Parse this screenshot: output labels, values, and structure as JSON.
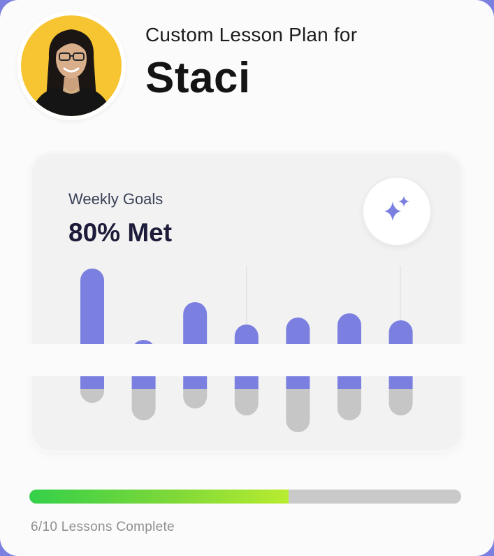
{
  "header": {
    "subtitle": "Custom Lesson Plan for",
    "student_name": "Staci",
    "avatar_bg": "#f7c531"
  },
  "goals": {
    "label": "Weekly Goals",
    "value_text": "80% Met",
    "sparkle_icon": "sparkle-icon"
  },
  "chart_data": {
    "type": "bar",
    "categories": [
      "",
      "",
      "",
      "",
      "",
      "",
      ""
    ],
    "series": [
      {
        "values": [
          172,
          70,
          124,
          92,
          102,
          108,
          98
        ],
        "color": "#7b80e0"
      },
      {
        "values": [
          20,
          45,
          28,
          38,
          62,
          45,
          38
        ],
        "color": "#c6c6c6"
      }
    ]
  },
  "progress": {
    "completed": 6,
    "total": 10,
    "label": "6/10 Lessons Complete"
  }
}
